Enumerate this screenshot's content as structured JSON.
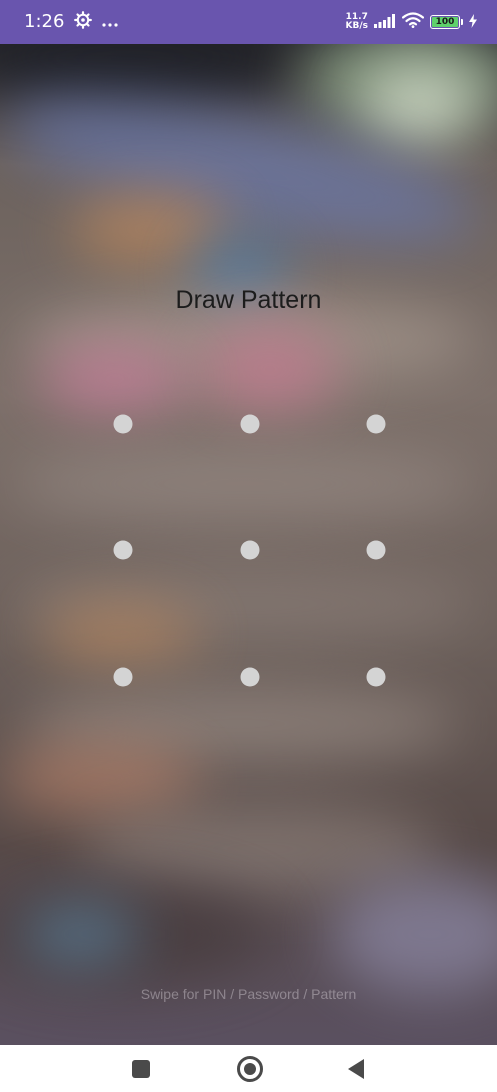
{
  "status_bar": {
    "time": "1:26",
    "net_speed_value": "11.7",
    "net_speed_unit": "KB/s",
    "battery": "100",
    "icons": [
      "settings-gear-icon",
      "more-dots-icon",
      "signal-icon",
      "wifi-icon",
      "battery-icon",
      "charging-bolt-icon"
    ],
    "accent_color": "#6955ae"
  },
  "lock_screen": {
    "title": "Draw Pattern",
    "pattern_grid": [
      "dot",
      "dot",
      "dot",
      "dot",
      "dot",
      "dot",
      "dot",
      "dot",
      "dot"
    ],
    "swipe_hint": "Swipe for PIN / Password / Pattern"
  },
  "nav_bar": {
    "buttons": [
      "recents-square-icon",
      "home-circle-icon",
      "back-triangle-icon"
    ]
  }
}
